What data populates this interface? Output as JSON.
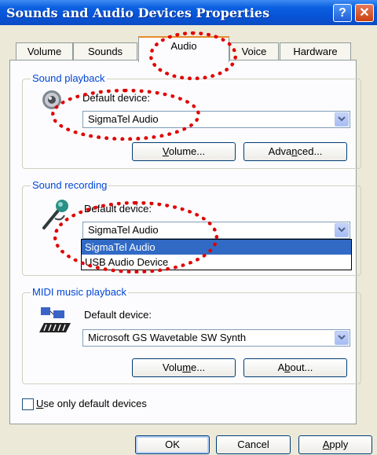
{
  "window": {
    "title": "Sounds and Audio Devices Properties",
    "help": "?",
    "close": "✕"
  },
  "tabs": [
    {
      "label": "Volume"
    },
    {
      "label": "Sounds"
    },
    {
      "label": "Audio",
      "active": true
    },
    {
      "label": "Voice"
    },
    {
      "label": "Hardware"
    }
  ],
  "playback": {
    "title": "Sound playback",
    "default_label": "Default device:",
    "device": "SigmaTel Audio",
    "volume_pre": "",
    "volume_key": "V",
    "volume_post": "olume...",
    "advanced_pre": "Adva",
    "advanced_key": "n",
    "advanced_post": "ced..."
  },
  "recording": {
    "title": "Sound recording",
    "default_label": "Default device:",
    "device": "SigmaTel Audio",
    "options": [
      "SigmaTel Audio",
      "USB Audio Device"
    ]
  },
  "midi": {
    "title": "MIDI music playback",
    "default_label": "Default device:",
    "device": "Microsoft GS Wavetable SW Synth",
    "volume_pre": "Volu",
    "volume_key": "m",
    "volume_post": "e...",
    "about_pre": "A",
    "about_key": "b",
    "about_post": "out..."
  },
  "checkbox": {
    "key": "U",
    "label_rest": "se only default devices",
    "checked": false
  },
  "footer": {
    "ok": "OK",
    "cancel": "Cancel",
    "apply_key": "A",
    "apply_rest": "pply"
  },
  "colors": {
    "titlebar": "#0853d6",
    "face": "#ece9d8",
    "group_title": "#0046d5",
    "highlight": "#316ac5",
    "annotation": "#e00000",
    "active_tab": "#e68b2c"
  }
}
